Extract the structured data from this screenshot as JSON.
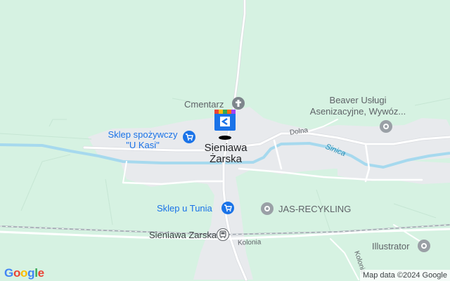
{
  "map": {
    "town_line1": "Sieniawa",
    "town_line2": "Żarska",
    "labels": {
      "cemetery": "Cmentarz",
      "shop_uKasi_line1": "Sklep spożywczy",
      "shop_uKasi_line2": "\"U Kasi\"",
      "beaver_line1": "Beaver Usługi",
      "beaver_line2": "Asenizacyjne, Wywóz...",
      "jas": "JAS-RECYKLING",
      "sklep_tunia": "Sklep u Tunia",
      "station": "Sieniawa Zarska",
      "illustrator": "Illustrator"
    },
    "roads": {
      "dolna": "Dolna",
      "kolonia": "Kolonia",
      "kolonia_vertical": "Kolonia"
    },
    "river": "Sinica",
    "icons": {
      "cemetery": "cemetery-icon",
      "shop": "shopping-cart-icon",
      "poi": "generic-poi-icon",
      "station": "train-station-icon",
      "marker": "search-result-marker-icon"
    },
    "colors": {
      "land": "#d6f2e2",
      "settlement": "#e8eaed",
      "river": "#a6d9ee",
      "poi_blue": "#1a73e8",
      "poi_grey": "#9aa0a6"
    }
  },
  "logo": "Google",
  "attribution": "Map data ©2024 Google"
}
